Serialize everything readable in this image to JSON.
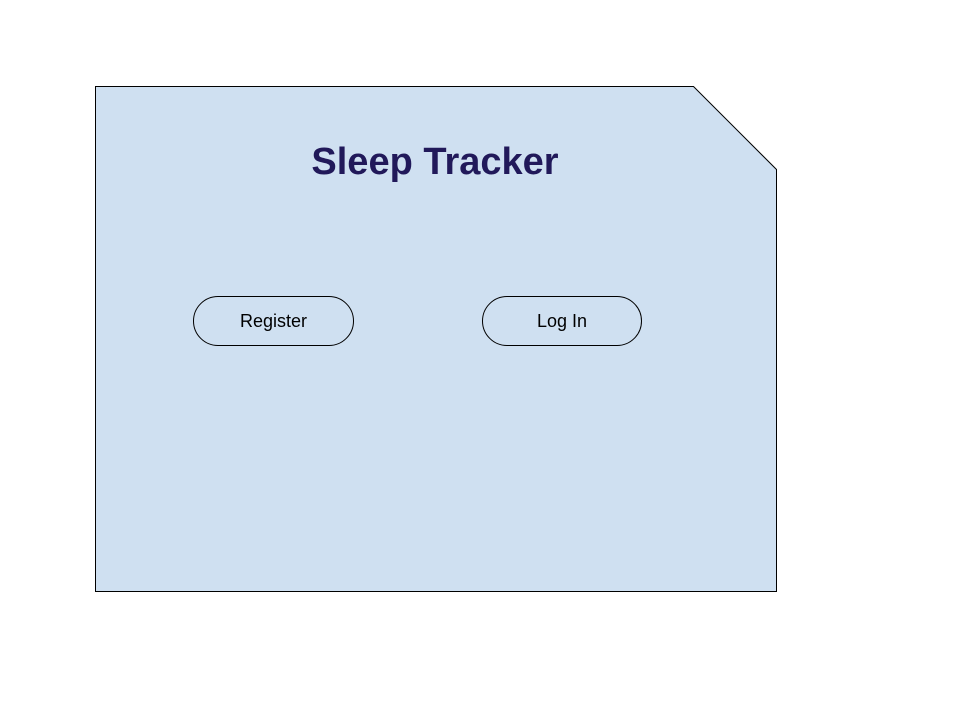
{
  "app": {
    "title": "Sleep Tracker"
  },
  "actions": {
    "register_label": "Register",
    "login_label": "Log In"
  },
  "colors": {
    "panel_fill": "#cfe0f1",
    "panel_border": "#000000",
    "title_text": "#21195a",
    "page_background": "#ffffff"
  }
}
